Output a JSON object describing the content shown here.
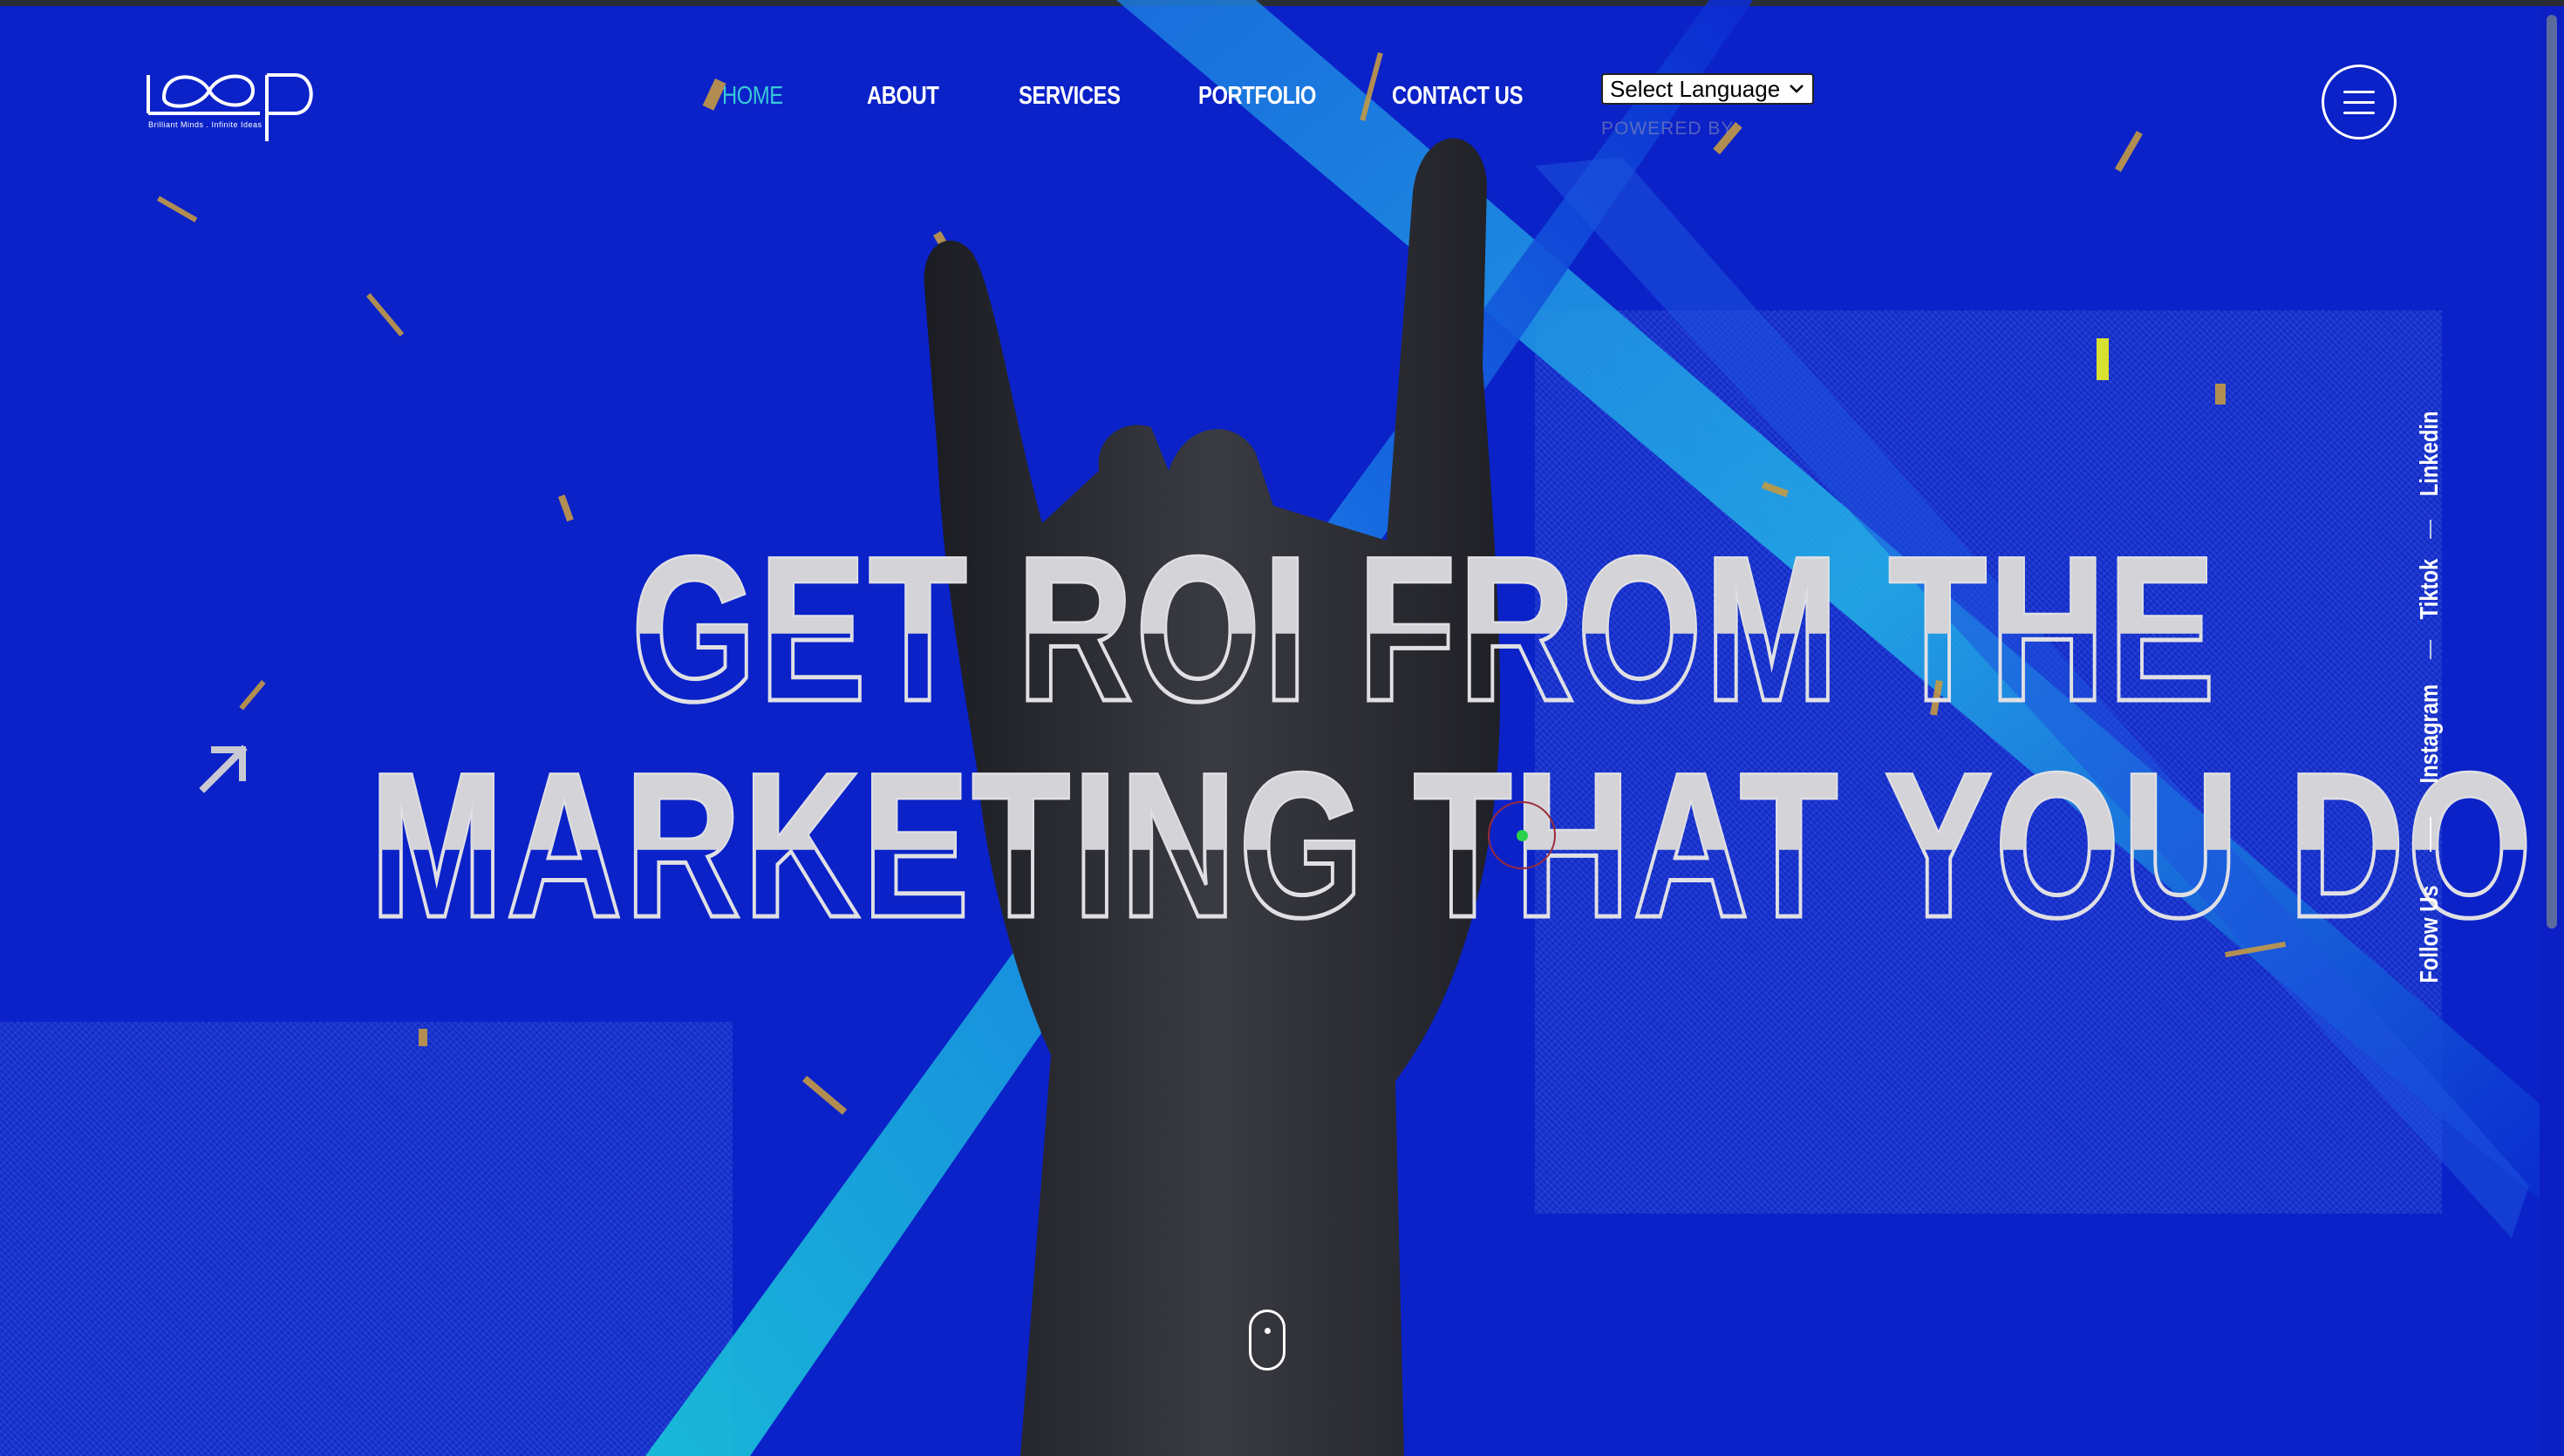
{
  "brand": {
    "logo_alt": "Loop",
    "tagline": "Brilliant Minds . Infinite Ideas"
  },
  "nav": {
    "items": [
      {
        "label": "HOME",
        "active": true
      },
      {
        "label": "ABOUT",
        "active": false
      },
      {
        "label": "SERVICES",
        "active": false
      },
      {
        "label": "PORTFOLIO",
        "active": false
      },
      {
        "label": "CONTACT US",
        "active": false
      }
    ]
  },
  "language": {
    "selected": "Select Language",
    "powered_by": "POWERED BY"
  },
  "hero": {
    "line1": "GET ROI FROM THE",
    "line2": "MARKETING THAT YOU DO."
  },
  "social": {
    "label": "Follow Us",
    "items": [
      "Instagram",
      "Tiktok",
      "Linkedin"
    ]
  },
  "icons": {
    "menu": "hamburger-menu-icon",
    "arrow": "arrow-up-right-icon",
    "scroll": "mouse-scroll-icon"
  },
  "colors": {
    "background": "#0b22c8",
    "accent_active": "#38c9d8",
    "text": "#ffffff",
    "headline": "#d4d4d8"
  }
}
